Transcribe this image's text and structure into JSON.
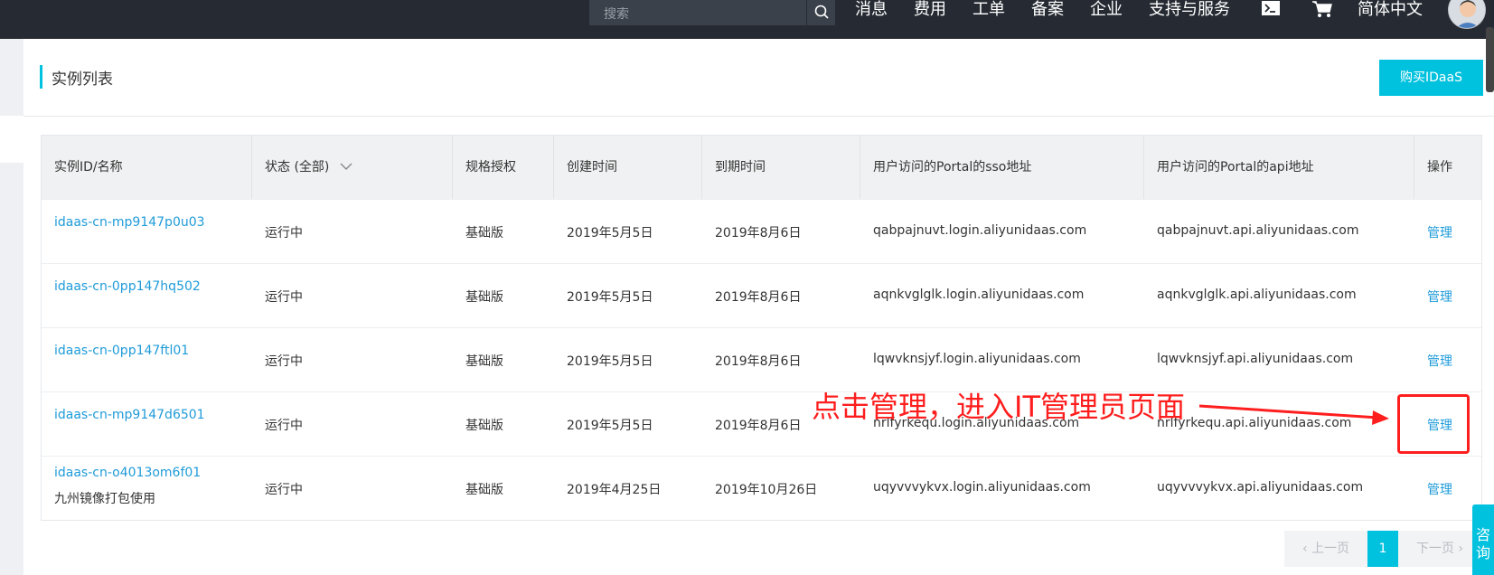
{
  "topbar": {
    "search_placeholder": "搜索",
    "nav": [
      "消息",
      "费用",
      "工单",
      "备案",
      "企业",
      "支持与服务",
      "简体中文"
    ],
    "icons": [
      "search-icon",
      "terminal-icon",
      "cart-icon",
      "avatar"
    ]
  },
  "page": {
    "title": "实例列表",
    "buy_button": "购买IDaaS"
  },
  "table": {
    "headers": [
      "实例ID/名称",
      "状态 (全部)",
      "规格授权",
      "创建时间",
      "到期时间",
      "用户访问的Portal的sso地址",
      "用户访问的Portal的api地址",
      "操作"
    ],
    "rows": [
      {
        "id": "idaas-cn-mp9147p0u03",
        "name": "",
        "status": "运行中",
        "spec": "基础版",
        "created": "2019年5月5日",
        "expires": "2019年8月6日",
        "sso": "qabpajnuvt.login.aliyunidaas.com",
        "api": "qabpajnuvt.api.aliyunidaas.com",
        "action": "管理"
      },
      {
        "id": "idaas-cn-0pp147hq502",
        "name": "",
        "status": "运行中",
        "spec": "基础版",
        "created": "2019年5月5日",
        "expires": "2019年8月6日",
        "sso": "aqnkvglglk.login.aliyunidaas.com",
        "api": "aqnkvglglk.api.aliyunidaas.com",
        "action": "管理"
      },
      {
        "id": "idaas-cn-0pp147ftl01",
        "name": "",
        "status": "运行中",
        "spec": "基础版",
        "created": "2019年5月5日",
        "expires": "2019年8月6日",
        "sso": "lqwvknsjyf.login.aliyunidaas.com",
        "api": "lqwvknsjyf.api.aliyunidaas.com",
        "action": "管理"
      },
      {
        "id": "idaas-cn-mp9147d6501",
        "name": "",
        "status": "运行中",
        "spec": "基础版",
        "created": "2019年5月5日",
        "expires": "2019年8月6日",
        "sso": "nrlfyrkequ.login.aliyunidaas.com",
        "api": "nrlfyrkequ.api.aliyunidaas.com",
        "action": "管理"
      },
      {
        "id": "idaas-cn-o4013om6f01",
        "name": "九州镜像打包使用",
        "status": "运行中",
        "spec": "基础版",
        "created": "2019年4月25日",
        "expires": "2019年10月26日",
        "sso": "uqyvvvykvx.login.aliyunidaas.com",
        "api": "uqyvvvykvx.api.aliyunidaas.com",
        "action": "管理"
      }
    ]
  },
  "pagination": {
    "prev": "上一页",
    "current": "1",
    "next": "下一页"
  },
  "consult": "咨询",
  "annotation": {
    "text": "点击管理，进入IT管理员页面",
    "color": "#ff1e1e"
  },
  "colors": {
    "accent": "#00c1de",
    "link": "#1f9bd9",
    "topbar": "#262b33"
  }
}
